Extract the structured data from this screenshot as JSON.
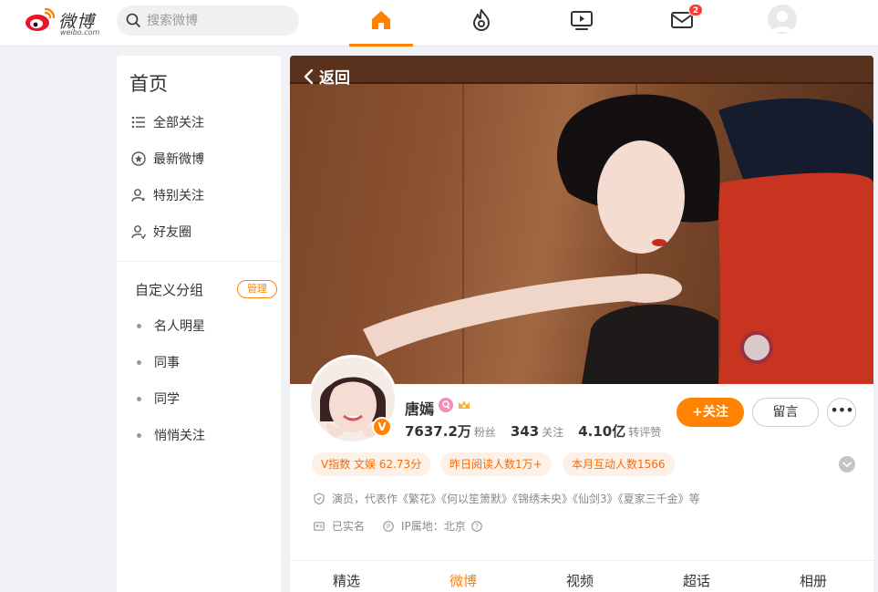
{
  "header": {
    "logo_text": "微博",
    "logo_sub": "weibo.com",
    "search_placeholder": "搜索微博",
    "messages_badge": "2",
    "accent_color": "#ff8200"
  },
  "sidebar": {
    "title": "首页",
    "items": [
      {
        "label": "全部关注",
        "icon": "list-icon"
      },
      {
        "label": "最新微博",
        "icon": "star-circle-icon"
      },
      {
        "label": "特别关注",
        "icon": "user-star-icon"
      },
      {
        "label": "好友圈",
        "icon": "users-icon"
      }
    ],
    "group_title": "自定义分组",
    "manage_label": "管理",
    "groups": [
      "名人明星",
      "同事",
      "同学",
      "悄悄关注"
    ]
  },
  "profile": {
    "back_label": "返回",
    "name": "唐嫣",
    "verified_badge": "V",
    "followers_num": "7637.2万",
    "followers_label": "粉丝",
    "following_num": "343",
    "following_label": "关注",
    "reposts_num": "4.10亿",
    "reposts_label": "转评赞",
    "follow_label": "+关注",
    "message_label": "留言",
    "more_label": "•••",
    "tags": [
      "V指数 文娱 62.73分",
      "昨日阅读人数1万+",
      "本月互动人数1566"
    ],
    "bio": "演员，代表作《繁花》《何以笙箫默》《锦绣未央》《仙剑3》《夏家三千金》等",
    "real_name": "已实名",
    "ip_location": "IP属地：北京"
  },
  "tabs": [
    "精选",
    "微博",
    "视频",
    "超话",
    "相册"
  ]
}
